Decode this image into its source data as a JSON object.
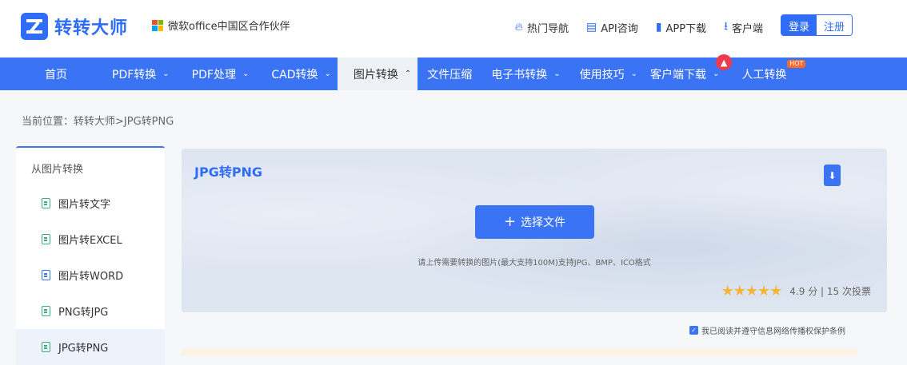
{
  "header": {
    "logo_text": "转转大师",
    "partner_text": "微软office中国区合作伙伴",
    "links": [
      {
        "label": "热门导航",
        "icon": "flame-icon"
      },
      {
        "label": "API咨询",
        "icon": "chat-icon"
      },
      {
        "label": "APP下载",
        "icon": "phone-icon"
      },
      {
        "label": "客户端",
        "icon": "download-icon"
      }
    ],
    "login_label": "登录",
    "register_label": "注册"
  },
  "nav": {
    "items": [
      {
        "label": "首页",
        "dropdown": false
      },
      {
        "label": "PDF转换",
        "dropdown": true
      },
      {
        "label": "PDF处理",
        "dropdown": true
      },
      {
        "label": "CAD转换",
        "dropdown": true
      },
      {
        "label": "图片转换",
        "dropdown": true,
        "active": true
      },
      {
        "label": "文件压缩",
        "dropdown": false
      },
      {
        "label": "电子书转换",
        "dropdown": true
      },
      {
        "label": "使用技巧",
        "dropdown": true
      },
      {
        "label": "客户端下载",
        "dropdown": true
      },
      {
        "label": "人工转换",
        "dropdown": false
      }
    ],
    "hot_badge": "HOT",
    "accent": "#3a73f3"
  },
  "breadcrumb": "当前位置：转转大师>JPG转PNG",
  "sidebar": {
    "title": "从图片转换",
    "items": [
      {
        "label": "图片转文字",
        "icon_color": "#3bb07a"
      },
      {
        "label": "图片转EXCEL",
        "icon_color": "#3bb07a"
      },
      {
        "label": "图片转WORD",
        "icon_color": "#3a73f3"
      },
      {
        "label": "PNG转JPG",
        "icon_color": "#3bb07a"
      },
      {
        "label": "JPG转PNG",
        "icon_color": "#3bb07a",
        "active": true
      }
    ]
  },
  "main": {
    "title": "JPG转PNG",
    "choose_button": "选择文件",
    "hint": "请上传需要转换的图片(最大支持100M)支持JPG、BMP、ICO格式",
    "rating": {
      "stars": 5,
      "score": "4.9",
      "score_unit": "分",
      "separator": "|",
      "votes": "15 次投票"
    },
    "agree_text": "我已阅读并遵守信息网络传播权保护条例"
  }
}
